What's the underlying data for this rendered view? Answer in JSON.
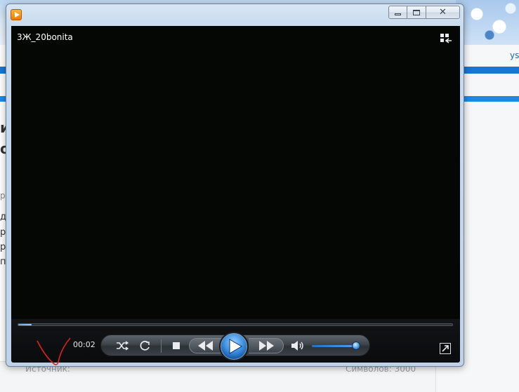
{
  "background_page": {
    "right_link": "ys",
    "left_letters": [
      "и",
      "о",
      "р",
      "д",
      "р",
      "р",
      "п"
    ],
    "source_label": "Источник:",
    "symbols_label": "Символов: 3000"
  },
  "player": {
    "video_title": "3Ж_20bonita",
    "elapsed_time": "00:02",
    "seek_progress_fraction": 0.03,
    "volume_fraction": 0.95,
    "icons": {
      "app": "media-player-app-icon",
      "switch_to_library": "switch-to-library-icon",
      "shuffle": "shuffle-icon",
      "repeat": "repeat-icon",
      "stop": "stop-icon",
      "previous": "previous-icon",
      "play": "play-icon",
      "next": "next-icon",
      "mute": "speaker-icon",
      "fullscreen": "fullscreen-icon"
    },
    "colors": {
      "video_background": "#050705",
      "accent_blue": "#3b8fe0",
      "annotation_red": "#e02020"
    }
  }
}
